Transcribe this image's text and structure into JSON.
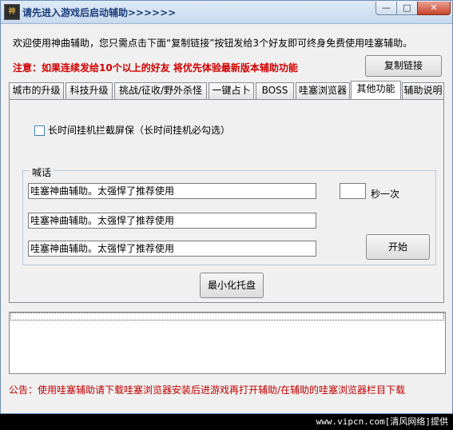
{
  "window": {
    "title": "请先进入游戏后启动辅助>>>>>>",
    "app_icon": "神",
    "min_glyph": "—",
    "max_glyph": "□",
    "close_glyph": "✕"
  },
  "header": {
    "welcome": "欢迎使用神曲辅助，您只需点击下面“复制链接”按钮发给3个好友即可终身免费使用哇塞辅助。",
    "notice_red": "注意：如果连续发给10个以上的好友  将优先体验最新版本辅助功能",
    "copy_button": "复制链接"
  },
  "tabs": [
    {
      "label": "城市的升级"
    },
    {
      "label": "科技升级"
    },
    {
      "label": "挑战/征收/野外杀怪"
    },
    {
      "label": "一键占卜"
    },
    {
      "label": "BOSS"
    },
    {
      "label": "哇塞浏览器"
    },
    {
      "label": "其他功能"
    },
    {
      "label": "辅助说明"
    }
  ],
  "active_tab": "其他功能",
  "panel": {
    "checkbox_label": "长时间挂机拦截屏保（长时间挂机必勾选）",
    "checkbox_checked": false,
    "group_title": "喊话",
    "shout_inputs": [
      "哇塞神曲辅助。太强悍了推荐使用",
      "哇塞神曲辅助。太强悍了推荐使用",
      "哇塞神曲辅助。太强悍了推荐使用"
    ],
    "interval_value": "",
    "interval_label": "秒一次",
    "start_button": "开始",
    "minimize_button": "最小化托盘"
  },
  "footer": {
    "notice": "公告：使用哇塞辅助请下载哇塞浏览器安装后进游戏再打开辅助/在辅助的哇塞浏览器栏目下载",
    "watermark": "www.vipcn.com[清风网络]提供"
  },
  "colors": {
    "red": "#d00000",
    "title_blue": "#1a3e7a"
  }
}
